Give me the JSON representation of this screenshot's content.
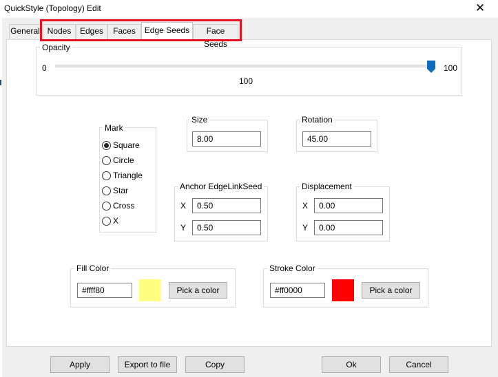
{
  "window": {
    "title": "QuickStyle (Topology) Edit",
    "close_glyph": "✕"
  },
  "tabs": [
    {
      "label": "General"
    },
    {
      "label": "Nodes"
    },
    {
      "label": "Edges"
    },
    {
      "label": "Faces"
    },
    {
      "label": "Edge Seeds",
      "active": true
    },
    {
      "label": "Face Seeds"
    }
  ],
  "opacity": {
    "label": "Opacity",
    "min": "0",
    "max": "100",
    "value": "100",
    "fraction": 1.0
  },
  "mark": {
    "label": "Mark",
    "selected": "Square",
    "options": [
      "Square",
      "Circle",
      "Triangle",
      "Star",
      "Cross",
      "X"
    ]
  },
  "size": {
    "label": "Size",
    "value": "8.00"
  },
  "rotation": {
    "label": "Rotation",
    "value": "45.00"
  },
  "anchor": {
    "label": "Anchor EdgeLinkSeed",
    "x_label": "X",
    "y_label": "Y",
    "x": "0.50",
    "y": "0.50"
  },
  "displacement": {
    "label": "Displacement",
    "x_label": "X",
    "y_label": "Y",
    "x": "0.00",
    "y": "0.00"
  },
  "fill_color": {
    "label": "Fill Color",
    "value": "#ffff80",
    "swatch": "#ffff80",
    "pick_label": "Pick a color"
  },
  "stroke_color": {
    "label": "Stroke Color",
    "value": "#ff0000",
    "swatch": "#ff0000",
    "pick_label": "Pick a color"
  },
  "footer": {
    "apply": "Apply",
    "export": "Export to file",
    "copy": "Copy",
    "ok": "Ok",
    "cancel": "Cancel"
  },
  "colors": {
    "highlight": "#e81123",
    "slider_thumb": "#0f6cbd"
  }
}
